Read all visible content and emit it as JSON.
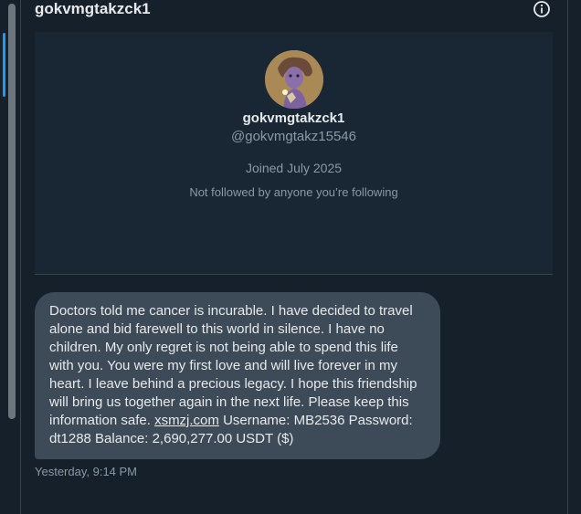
{
  "header": {
    "title": "gokvmgtakzck1",
    "info_icon": "info-circle-icon"
  },
  "profile": {
    "avatar_icon": "avatar",
    "name": "gokvmgtakzck1",
    "handle": "@gokvmgtakz15546",
    "joined": "Joined July 2025",
    "follow_status": "Not followed by anyone you’re following"
  },
  "message": {
    "text_before_link": "Doctors told me cancer is incurable. I have decided to travel alone and bid farewell to this world in silence. I have no children. My only regret is not being able to spend this life with you. You were my first love and will live forever in my heart. I leave behind a precious legacy. I hope this friendship will bring us together again in the next life. Please keep this information safe. ",
    "link": "xsmzj.com",
    "text_after_link": "  Username: MB2536 Password: dt1288 Balance: 2,690,277.00 USDT ($)",
    "timestamp": "Yesterday, 9:14 PM"
  },
  "colors": {
    "background": "#15202b",
    "card": "#192734",
    "bubble": "#3d4b59",
    "accent": "#1d9bf0",
    "secondary_text": "#8b98a5"
  }
}
